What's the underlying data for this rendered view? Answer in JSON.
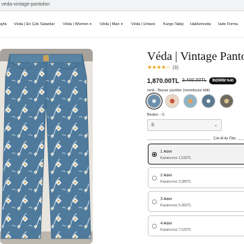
{
  "browser": {
    "url": "veda-vintage-pantolon"
  },
  "nav": {
    "items": [
      {
        "label": "ayfa",
        "dropdown": false
      },
      {
        "label": "Véda | En Çok Satanlar",
        "dropdown": false
      },
      {
        "label": "Véda | Women",
        "dropdown": true
      },
      {
        "label": "Véda | Man",
        "dropdown": true
      },
      {
        "label": "Véda | Unisex",
        "dropdown": false
      },
      {
        "label": "Kargo Takip",
        "dropdown": false
      },
      {
        "label": "Hakkımızda",
        "dropdown": false
      },
      {
        "label": "İade Formu",
        "dropdown": false
      }
    ],
    "chevron": "▾"
  },
  "product": {
    "title": "Véda | Vintage Pantol",
    "stars": "★★★★☆",
    "rating_value": 4,
    "rating_count": "(3)",
    "price": "1,870.00TL",
    "old_price": "3,400.00TL",
    "discount_badge": "İNDİRİM %40",
    "color_label": "renk - Beyaz çiçekler (neredeyse bitti)",
    "size_label": "Beden - S",
    "size_value": "S",
    "size_chevron": "⌄",
    "bundle_divider": "Çok Al Az Öde",
    "bundle_options": [
      {
        "title": "1 Adet",
        "subtitle": "Kazancınız 1,530TL",
        "selected": true
      },
      {
        "title": "2 Adet",
        "subtitle": "Kazancınız 3,380TL",
        "selected": false
      },
      {
        "title": "3 Adet",
        "subtitle": "Kazancınız 5,360TL",
        "selected": false
      },
      {
        "title": "4 Adet",
        "subtitle": "Kazancınız 7,520TL",
        "selected": false
      }
    ]
  },
  "colors": {
    "denim": "#4f7a9c",
    "star": "#e8a317",
    "badge_bg": "#111111"
  }
}
